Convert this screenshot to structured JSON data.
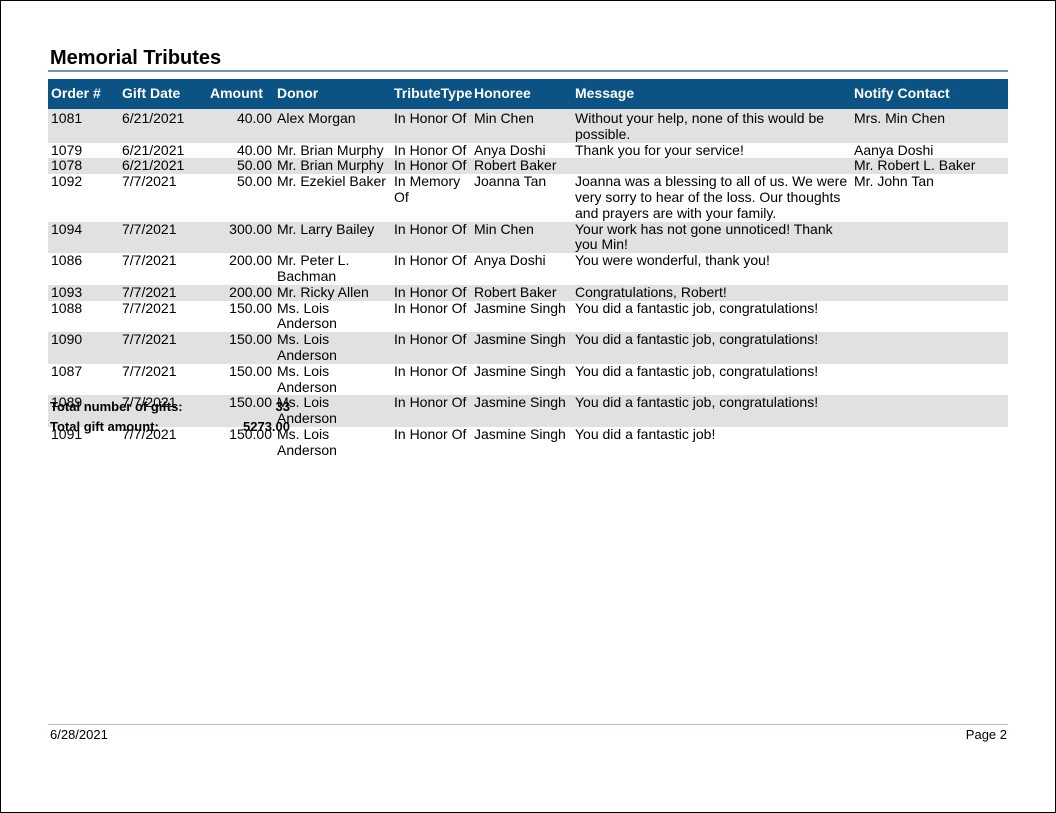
{
  "report": {
    "title": "Memorial Tributes",
    "columns": [
      "Order #",
      "Gift Date",
      "Amount",
      "Donor",
      "TributeType",
      "Honoree",
      "Message",
      "Notify Contact"
    ],
    "rows": [
      {
        "order": "1081",
        "date": "6/21/2021",
        "amount": "40.00",
        "donor": "Alex Morgan",
        "type": "In Honor Of",
        "honoree": "Min Chen",
        "message": "Without your help, none of this would be possible.",
        "notify": "Mrs. Min Chen"
      },
      {
        "order": "1079",
        "date": "6/21/2021",
        "amount": "40.00",
        "donor": "Mr. Brian Murphy",
        "type": "In Honor Of",
        "honoree": "Anya Doshi",
        "message": "Thank you for your service!",
        "notify": "Aanya Doshi"
      },
      {
        "order": "1078",
        "date": "6/21/2021",
        "amount": "50.00",
        "donor": "Mr. Brian Murphy",
        "type": "In Honor Of",
        "honoree": "Robert Baker",
        "message": "",
        "notify": "Mr. Robert L. Baker"
      },
      {
        "order": "1092",
        "date": "7/7/2021",
        "amount": "50.00",
        "donor": "Mr. Ezekiel Baker",
        "type": "In Memory Of",
        "honoree": "Joanna Tan",
        "message": "Joanna was a blessing to all of us. We were very sorry to hear of the loss. Our thoughts and prayers are with your family.",
        "notify": "Mr. John Tan"
      },
      {
        "order": "1094",
        "date": "7/7/2021",
        "amount": "300.00",
        "donor": "Mr. Larry Bailey",
        "type": "In Honor Of",
        "honoree": "Min Chen",
        "message": "Your work has not gone unnoticed! Thank you Min!",
        "notify": ""
      },
      {
        "order": "1086",
        "date": "7/7/2021",
        "amount": "200.00",
        "donor": "Mr. Peter L. Bachman",
        "type": "In Honor Of",
        "honoree": "Anya Doshi",
        "message": "You were wonderful, thank you!",
        "notify": ""
      },
      {
        "order": "1093",
        "date": "7/7/2021",
        "amount": "200.00",
        "donor": "Mr. Ricky Allen",
        "type": "In Honor Of",
        "honoree": "Robert Baker",
        "message": "Congratulations, Robert!",
        "notify": ""
      },
      {
        "order": "1088",
        "date": "7/7/2021",
        "amount": "150.00",
        "donor": "Ms. Lois Anderson",
        "type": "In Honor Of",
        "honoree": "Jasmine Singh",
        "message": "You did a fantastic job, congratulations!",
        "notify": ""
      },
      {
        "order": "1090",
        "date": "7/7/2021",
        "amount": "150.00",
        "donor": "Ms. Lois Anderson",
        "type": "In Honor Of",
        "honoree": "Jasmine Singh",
        "message": "You did a fantastic job, congratulations!",
        "notify": ""
      },
      {
        "order": "1087",
        "date": "7/7/2021",
        "amount": "150.00",
        "donor": "Ms. Lois Anderson",
        "type": "In Honor Of",
        "honoree": "Jasmine Singh",
        "message": "You did a fantastic job, congratulations!",
        "notify": ""
      },
      {
        "order": "1089",
        "date": "7/7/2021",
        "amount": "150.00",
        "donor": "Ms. Lois Anderson",
        "type": "In Honor Of",
        "honoree": "Jasmine Singh",
        "message": "You did a fantastic job, congratulations!",
        "notify": ""
      },
      {
        "order": "1091",
        "date": "7/7/2021",
        "amount": "150.00",
        "donor": "Ms. Lois Anderson",
        "type": "In Honor Of",
        "honoree": "Jasmine Singh",
        "message": "You did a fantastic job!",
        "notify": ""
      }
    ]
  },
  "totals": {
    "count_label": "Total number of gifts:",
    "count_value": "33",
    "amount_label": "Total gift amount:",
    "amount_value": "5273.00"
  },
  "footer": {
    "date": "6/28/2021",
    "page": "Page 2"
  },
  "colors": {
    "header_bg": "#0b5384",
    "row_shade": "#e1e1e1",
    "title_rule": "#6f97bc"
  }
}
